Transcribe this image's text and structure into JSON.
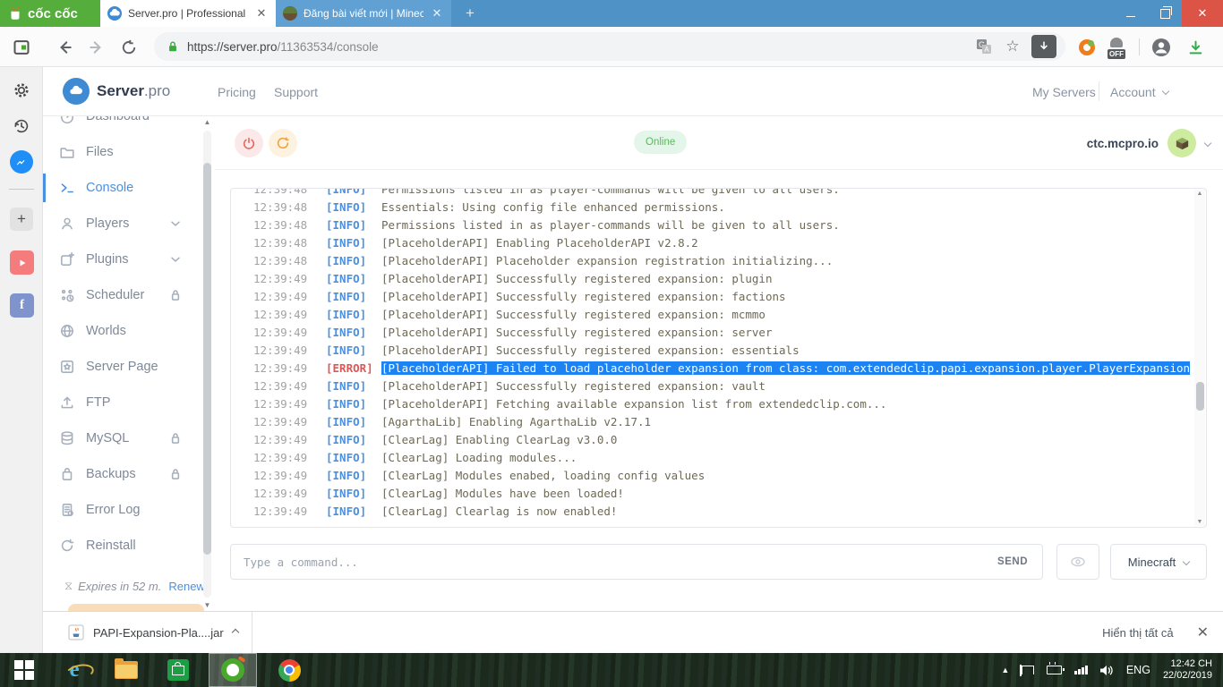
{
  "browser": {
    "brand": "cốc cốc",
    "tabs": [
      {
        "title": "Server.pro | Professional G",
        "favicon": "serverpro-favicon",
        "active": true
      },
      {
        "title": "Đăng bài viết mới | Minec",
        "favicon": "minecraft-favicon",
        "active": false
      }
    ],
    "new_tab_label": "+",
    "url_host": "https://server.pro",
    "url_path": "/11363534/console"
  },
  "header": {
    "logo_bold": "Server",
    "logo_light": ".pro",
    "nav": {
      "pricing": "Pricing",
      "support": "Support"
    },
    "right": {
      "my_servers": "My Servers",
      "account": "Account"
    }
  },
  "sidebar": {
    "items": [
      {
        "label": "Dashboard",
        "icon": "dashboard"
      },
      {
        "label": "Files",
        "icon": "files"
      },
      {
        "label": "Console",
        "icon": "console",
        "active": true
      },
      {
        "label": "Players",
        "icon": "players",
        "chevron": true
      },
      {
        "label": "Plugins",
        "icon": "plugins",
        "chevron": true
      },
      {
        "label": "Scheduler",
        "icon": "scheduler",
        "locked": true
      },
      {
        "label": "Worlds",
        "icon": "worlds"
      },
      {
        "label": "Server Page",
        "icon": "server-page"
      },
      {
        "label": "FTP",
        "icon": "ftp"
      },
      {
        "label": "MySQL",
        "icon": "mysql",
        "locked": true
      },
      {
        "label": "Backups",
        "icon": "backups",
        "locked": true
      },
      {
        "label": "Error Log",
        "icon": "error-log"
      },
      {
        "label": "Reinstall",
        "icon": "reinstall"
      }
    ],
    "expires_text": "Expires in 52 m.",
    "renew_label": "Renew"
  },
  "console": {
    "status": "Online",
    "server_address": "ctc.mcpro.io",
    "command_placeholder": "Type a command...",
    "send_label": "SEND",
    "version_label": "Minecraft",
    "log": [
      {
        "time": "12:39:48",
        "level": "INFO",
        "message": "Permissions listed in as player-commands will be given to all users.",
        "partial": true
      },
      {
        "time": "12:39:48",
        "level": "INFO",
        "message": "Essentials: Using config file enhanced permissions."
      },
      {
        "time": "12:39:48",
        "level": "INFO",
        "message": "Permissions listed in as player-commands will be given to all users."
      },
      {
        "time": "12:39:48",
        "level": "INFO",
        "message": "[PlaceholderAPI] Enabling PlaceholderAPI v2.8.2"
      },
      {
        "time": "12:39:48",
        "level": "INFO",
        "message": "[PlaceholderAPI] Placeholder expansion registration initializing..."
      },
      {
        "time": "12:39:49",
        "level": "INFO",
        "message": "[PlaceholderAPI] Successfully registered expansion: plugin"
      },
      {
        "time": "12:39:49",
        "level": "INFO",
        "message": "[PlaceholderAPI] Successfully registered expansion: factions"
      },
      {
        "time": "12:39:49",
        "level": "INFO",
        "message": "[PlaceholderAPI] Successfully registered expansion: mcmmo"
      },
      {
        "time": "12:39:49",
        "level": "INFO",
        "message": "[PlaceholderAPI] Successfully registered expansion: server"
      },
      {
        "time": "12:39:49",
        "level": "INFO",
        "message": "[PlaceholderAPI] Successfully registered expansion: essentials"
      },
      {
        "time": "12:39:49",
        "level": "ERROR",
        "message": "[PlaceholderAPI] Failed to load placeholder expansion from class: com.extendedclip.papi.expansion.player.PlayerExpansion",
        "selected": true
      },
      {
        "time": "12:39:49",
        "level": "INFO",
        "message": "[PlaceholderAPI] Successfully registered expansion: vault"
      },
      {
        "time": "12:39:49",
        "level": "INFO",
        "message": "[PlaceholderAPI] Fetching available expansion list from extendedclip.com..."
      },
      {
        "time": "12:39:49",
        "level": "INFO",
        "message": "[AgarthaLib] Enabling AgarthaLib v2.17.1"
      },
      {
        "time": "12:39:49",
        "level": "INFO",
        "message": "[ClearLag] Enabling ClearLag v3.0.0"
      },
      {
        "time": "12:39:49",
        "level": "INFO",
        "message": "[ClearLag] Loading modules..."
      },
      {
        "time": "12:39:49",
        "level": "INFO",
        "message": "[ClearLag] Modules enabed, loading config values"
      },
      {
        "time": "12:39:49",
        "level": "INFO",
        "message": "[ClearLag] Modules have been loaded!"
      },
      {
        "time": "12:39:49",
        "level": "INFO",
        "message": "[ClearLag] Clearlag is now enabled!"
      }
    ]
  },
  "download_bar": {
    "file_name": "PAPI-Expansion-Pla....jar",
    "show_all_label": "Hiển thị tất cả"
  },
  "taskbar": {
    "language": "ENG",
    "time": "12:42 CH",
    "date": "22/02/2019"
  },
  "colors": {
    "accent_blue": "#4a90e2",
    "error_red": "#e25555",
    "selection_blue": "#1d83f2",
    "online_green": "#5cb85c",
    "coc_green": "#55ad3c",
    "tabbar_blue": "#4f92c6"
  }
}
